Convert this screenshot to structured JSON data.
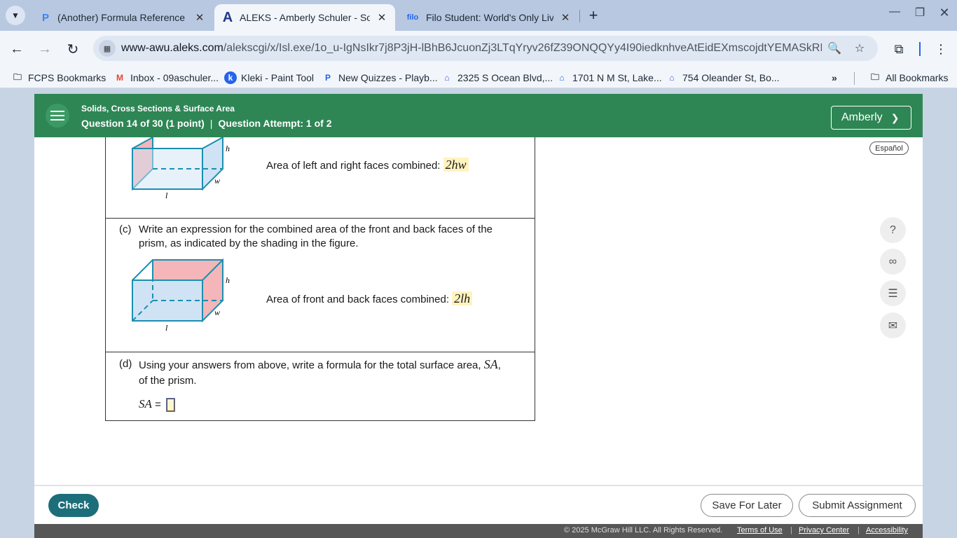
{
  "browser": {
    "tabs": [
      {
        "title": "(Another) Formula Reference Sheet",
        "favicon": "P",
        "active": false
      },
      {
        "title": "ALEKS - Amberly Schuler - Solids",
        "favicon": "A",
        "active": true
      },
      {
        "title": "Filo Student: World's Only Live Instant",
        "favicon": "filo",
        "active": false
      }
    ],
    "url_host": "www-awu.aleks.com",
    "url_path": "/alekscgi/x/Isl.exe/1o_u-IgNsIkr7j8P3jH-lBhB6JcuonZj3LTqYryv26fZ39ONQQYy4I90iedknhveAtEidEXmscojdtYEMASkRKty3...",
    "bookmarks": [
      {
        "label": "FCPS Bookmarks",
        "icon": "folder-icon"
      },
      {
        "label": "Inbox - 09aschuler...",
        "icon": "gmail-icon"
      },
      {
        "label": "Kleki - Paint Tool",
        "icon": "kleki-icon"
      },
      {
        "label": "New Quizzes - Playb...",
        "icon": "quizizz-icon"
      },
      {
        "label": "2325 S Ocean Blvd,...",
        "icon": "zillow-icon"
      },
      {
        "label": "1701 N M St, Lake...",
        "icon": "zillow-icon"
      },
      {
        "label": "754 Oleander St, Bo...",
        "icon": "zillow-icon"
      }
    ],
    "more_bookmarks": "»",
    "all_bookmarks": "All Bookmarks"
  },
  "header": {
    "topic": "Solids, Cross Sections & Surface Area",
    "question": "Question 14 of 30 (1 point)",
    "separator": "|",
    "attempt": "Question Attempt: 1 of 2",
    "user": "Amberly",
    "language": "Español"
  },
  "problem": {
    "part_b_label": "Area of left and right faces combined:",
    "part_b_answer": "2hw",
    "part_c_tag": "(c)",
    "part_c_line1": "Write an expression for the combined area of the front and back faces of the",
    "part_c_line2": "prism, as indicated by the shading in the figure.",
    "part_c_label": "Area of front and back faces combined:",
    "part_c_answer": "2lh",
    "part_d_tag": "(d)",
    "part_d_line1a": "Using your answers from above, write a formula for the total surface area,",
    "part_d_sa": "SA",
    "part_d_line1b": ",",
    "part_d_line2": "of the prism.",
    "sa_prefix": "SA",
    "equals": "=",
    "dim_h": "h",
    "dim_w": "w",
    "dim_l": "l"
  },
  "actions": {
    "check": "Check",
    "save": "Save For Later",
    "submit": "Submit Assignment"
  },
  "footer": {
    "copyright": "© 2025 McGraw Hill LLC. All Rights Reserved.",
    "terms": "Terms of Use",
    "privacy": "Privacy Center",
    "accessibility": "Accessibility",
    "sep": "|"
  },
  "colors": {
    "aleks_green": "#2e8655",
    "check_teal": "#1c6e7a",
    "shade_pink": "#f4b6b9",
    "face_blue": "#cfe3f5",
    "edge_teal": "#1b8fb0",
    "answer_highlight": "#fff3bf"
  }
}
